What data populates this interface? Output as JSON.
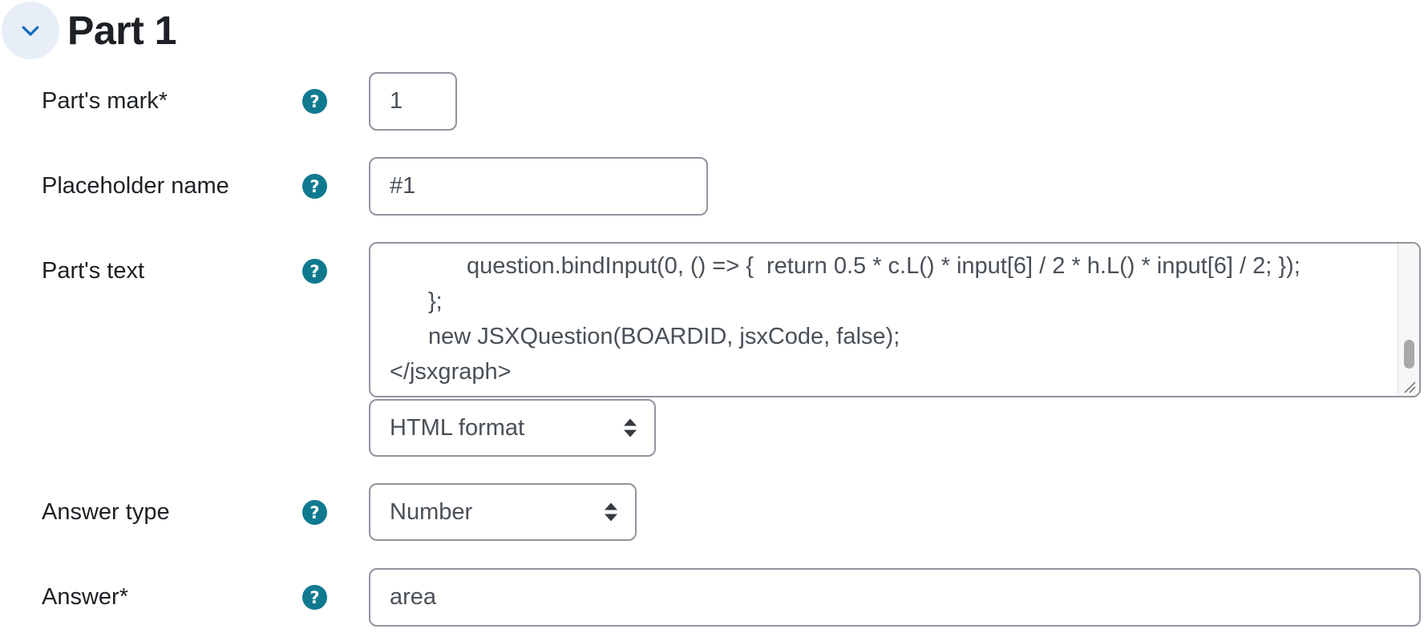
{
  "section": {
    "title": "Part 1"
  },
  "fields": {
    "mark": {
      "label": "Part's mark*",
      "value": "1"
    },
    "placeholder": {
      "label": "Placeholder name",
      "value": "#1"
    },
    "text": {
      "label": "Part's text",
      "lines": [
        "question.bindInput(0, () => {  return 0.5 * c.L() * input[6] / 2 * h.L() * input[6] / 2; });",
        "};",
        "new JSXQuestion(BOARDID, jsxCode, false);",
        "</jsxgraph>"
      ],
      "format": "HTML format"
    },
    "answer_type": {
      "label": "Answer type",
      "value": "Number"
    },
    "answer": {
      "label": "Answer*",
      "value": "area"
    }
  },
  "help_glyph": "?",
  "colors": {
    "help_bg": "#0f7a8f",
    "collapse_bg": "#e7eef7",
    "collapse_icon": "#0f6cbf",
    "border": "#8f959e"
  },
  "icons": {
    "collapse": "chevron-down-icon",
    "help": "question-circle-icon",
    "select": "sort-arrows-icon"
  }
}
